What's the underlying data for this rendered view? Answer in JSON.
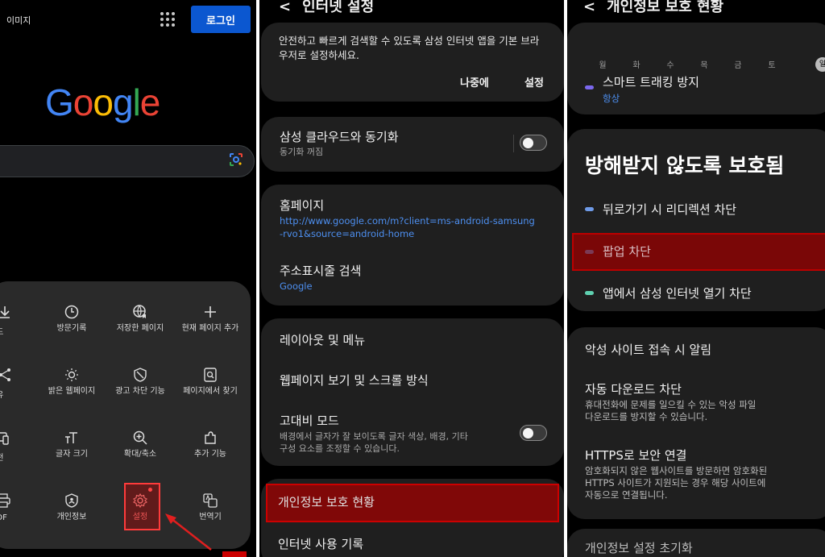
{
  "panel1": {
    "images_label": "이미지",
    "login_label": "로그인",
    "logo_letters": [
      {
        "ch": "G",
        "color": "#4285F4"
      },
      {
        "ch": "o",
        "color": "#EA4335"
      },
      {
        "ch": "o",
        "color": "#FBBC05"
      },
      {
        "ch": "g",
        "color": "#4285F4"
      },
      {
        "ch": "l",
        "color": "#34A853"
      },
      {
        "ch": "e",
        "color": "#EA4335"
      }
    ],
    "menu": {
      "row1": {
        "partial": "로드",
        "items": [
          "방문기록",
          "저장한 페이지",
          "현재 페이지 추가"
        ]
      },
      "row2": {
        "partial": "공유",
        "items": [
          "밝은 웹페이지",
          "광고 차단 기능",
          "페이지에서 찾기"
        ]
      },
      "row3": {
        "partial": "버전",
        "items": [
          "글자 크기",
          "확대/축소",
          "추가 기능"
        ]
      },
      "row4": {
        "partial": "/PDF",
        "items": [
          "개인정보",
          "설정",
          "번역기"
        ]
      }
    }
  },
  "panel2": {
    "header": "인터넷 설정",
    "banner_text": "안전하고 빠르게 검색할 수 있도록 삼성 인터넷 앱을 기본 브라우저로 설정하세요.",
    "banner_later": "나중에",
    "banner_settings": "설정",
    "sync_title": "삼성 클라우드와 동기화",
    "sync_sub": "동기화 꺼짐",
    "homepage_title": "홈페이지",
    "homepage_url_1": "http://www.google.com/m?client=ms-android-samsung",
    "homepage_url_2": "-rvo1&source=android-home",
    "addressbar_title": "주소표시줄 검색",
    "addressbar_value": "Google",
    "layout_title": "레이아웃 및 메뉴",
    "webview_title": "웹페이지 보기 및 스크롤 방식",
    "contrast_title": "고대비 모드",
    "contrast_sub_1": "배경에서 글자가 잘 보이도록 글자 색상, 배경, 기타",
    "contrast_sub_2": "구성 요소를 조정할 수 있습니다.",
    "privacy_title": "개인정보 보호 현황",
    "history_title": "인터넷 사용 기록"
  },
  "panel3": {
    "header": "개인정보 보호 현황",
    "days": [
      "월",
      "화",
      "수",
      "목",
      "금",
      "토",
      "일"
    ],
    "tracking_title": "스마트 트래킹 방지",
    "tracking_value": "항상",
    "big_title": "방해받지 않도록 보호됨",
    "item_redirect": "뒤로가기 시 리디렉션 차단",
    "item_popup": "팝업 차단",
    "item_app": "앱에서 삼성 인터넷 열기 차단",
    "malicious_title": "악성 사이트 접속 시 알림",
    "download_title": "자동 다운로드 차단",
    "download_sub_1": "휴대전화에 문제를 일으킬 수 있는 악성 파일",
    "download_sub_2": "다운로드를 방지할 수 있습니다.",
    "https_title": "HTTPS로 보안 연결",
    "https_sub_1": "암호화되지 않은 웹사이트를 방문하면 암호화된",
    "https_sub_2": "HTTPS 사이트가 지원되는 경우 해당 사이트에",
    "https_sub_3": "자동으로 연결됩니다.",
    "reset_title": "개인정보 설정 초기화",
    "colors": {
      "tracking_dot": "#7b68ee",
      "redirect_dot": "#6f9be8",
      "popup_dot": "#7b3a55",
      "app_dot": "#5fd0b0",
      "link": "#4d8ff0"
    }
  }
}
